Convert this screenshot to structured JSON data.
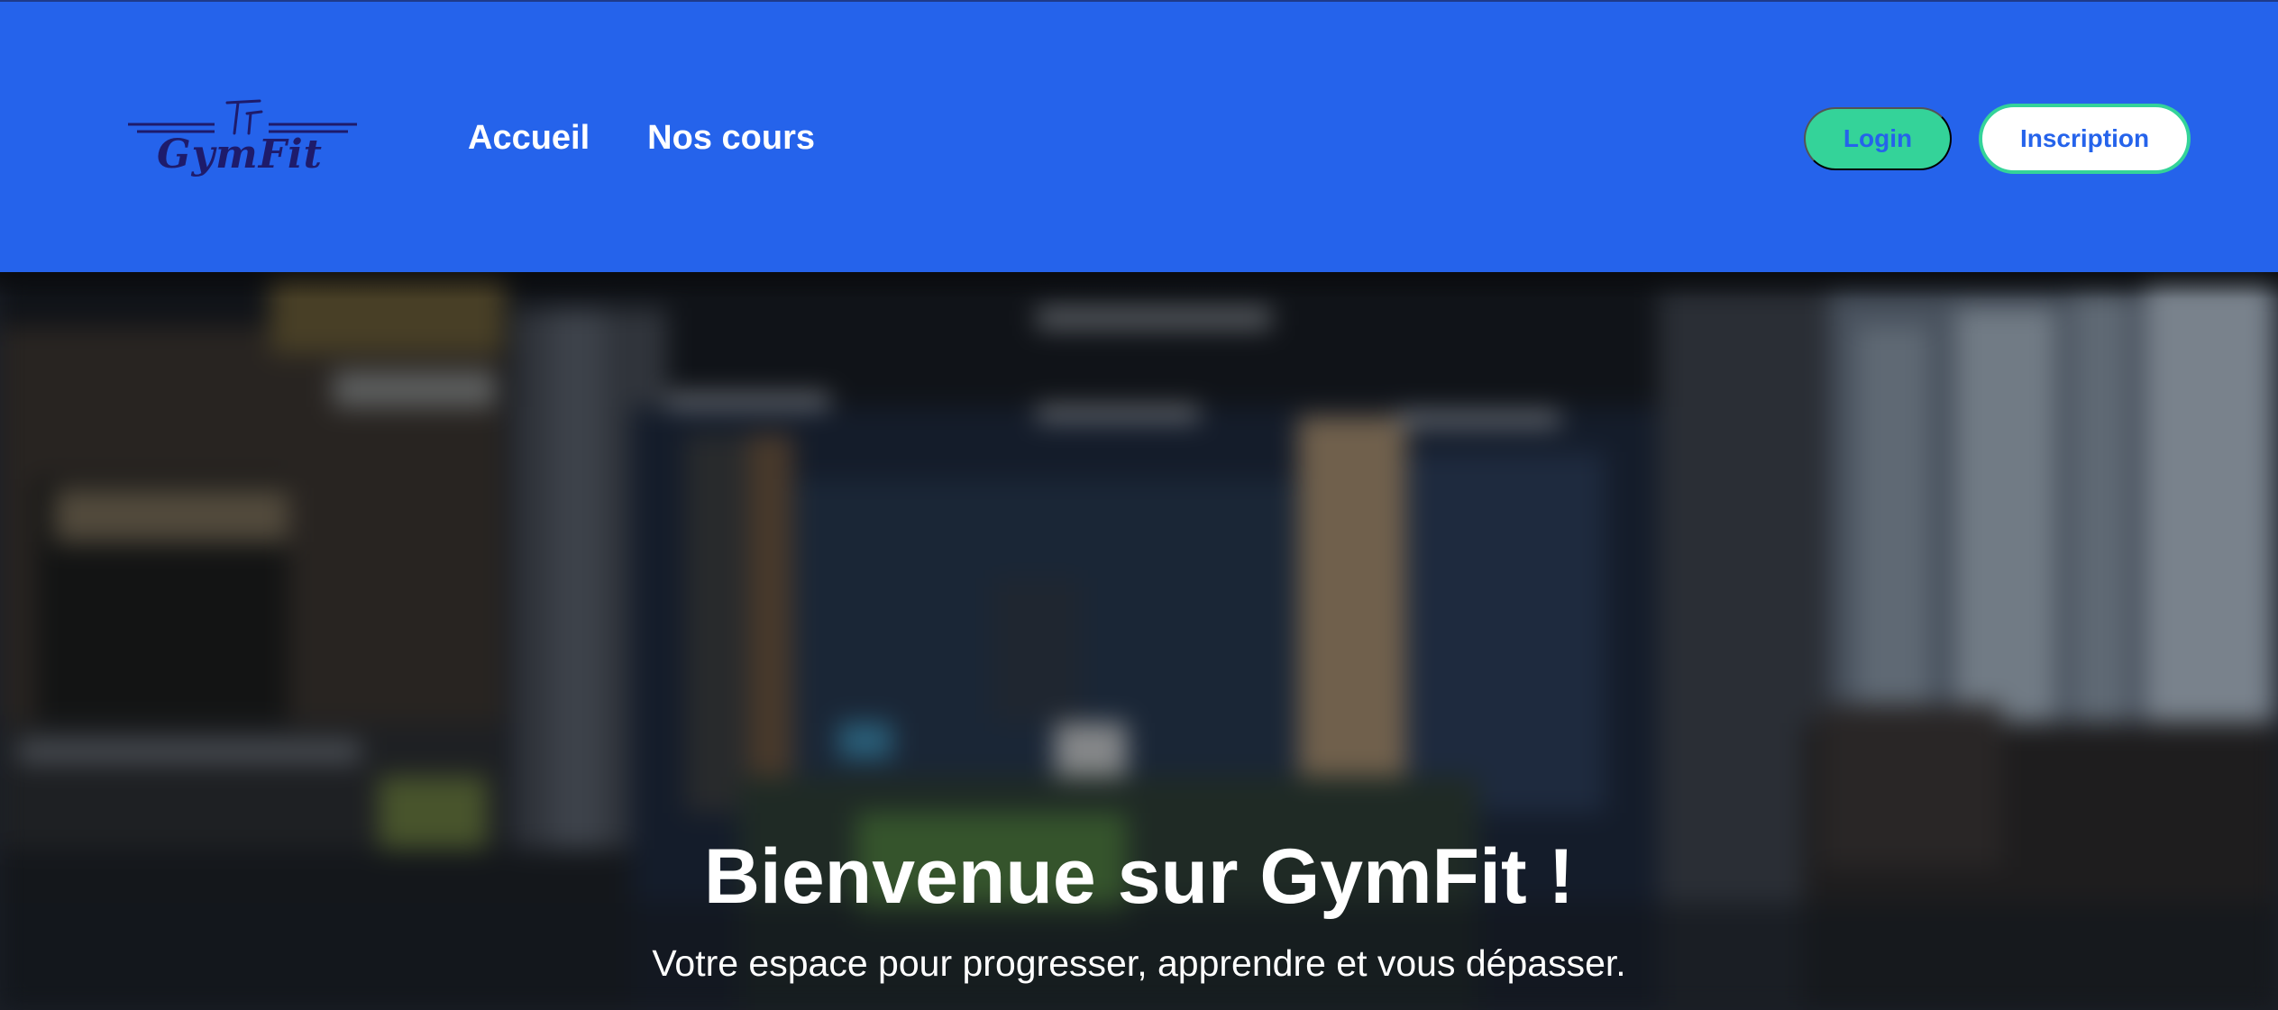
{
  "header": {
    "logo_text": "GymFit",
    "nav": {
      "home_label": "Accueil",
      "courses_label": "Nos cours"
    },
    "login_label": "Login",
    "signup_label": "Inscription"
  },
  "hero": {
    "title": "Bienvenue sur GymFit !",
    "subtitle": "Votre espace pour progresser, apprendre et vous dépasser."
  },
  "colors": {
    "header_bg": "#2563eb",
    "accent_green": "#34d399",
    "logo_navy": "#1e1b6b",
    "button_text": "#2563eb"
  },
  "icons": {
    "logo_mark": "gymfit-logo-icon"
  }
}
